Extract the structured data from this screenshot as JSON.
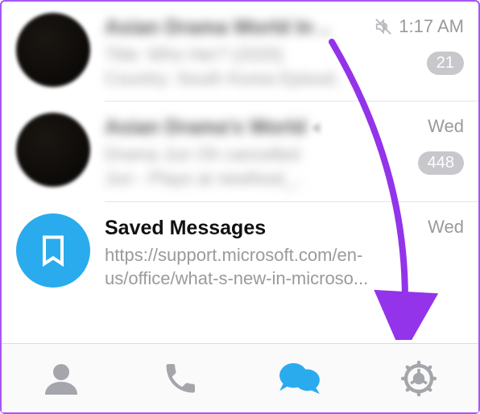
{
  "chats": [
    {
      "title": "Asian Drama World In ..",
      "preview_line1": "Title: Who Her? (2020)",
      "preview_line2": "Country: South Korea Episod..",
      "time": "1:17 AM",
      "muted": true,
      "badge": "21"
    },
    {
      "title": "Asian Drama's World",
      "preview_line1": "Drama Jun Oh cancelled",
      "preview_line2": "Jun - Plays at newfood_..",
      "time": "Wed",
      "muted": true,
      "badge": "448"
    },
    {
      "title": "Saved Messages",
      "preview": "https://support.microsoft.com/en-us/office/what-s-new-in-microso...",
      "time": "Wed"
    }
  ],
  "nav": {
    "contacts": "Contacts",
    "calls": "Calls",
    "chats": "Chats",
    "settings": "Settings"
  },
  "colors": {
    "accent": "#2aabee",
    "annotation": "#9333ea",
    "inactive": "#a5a5ac"
  }
}
